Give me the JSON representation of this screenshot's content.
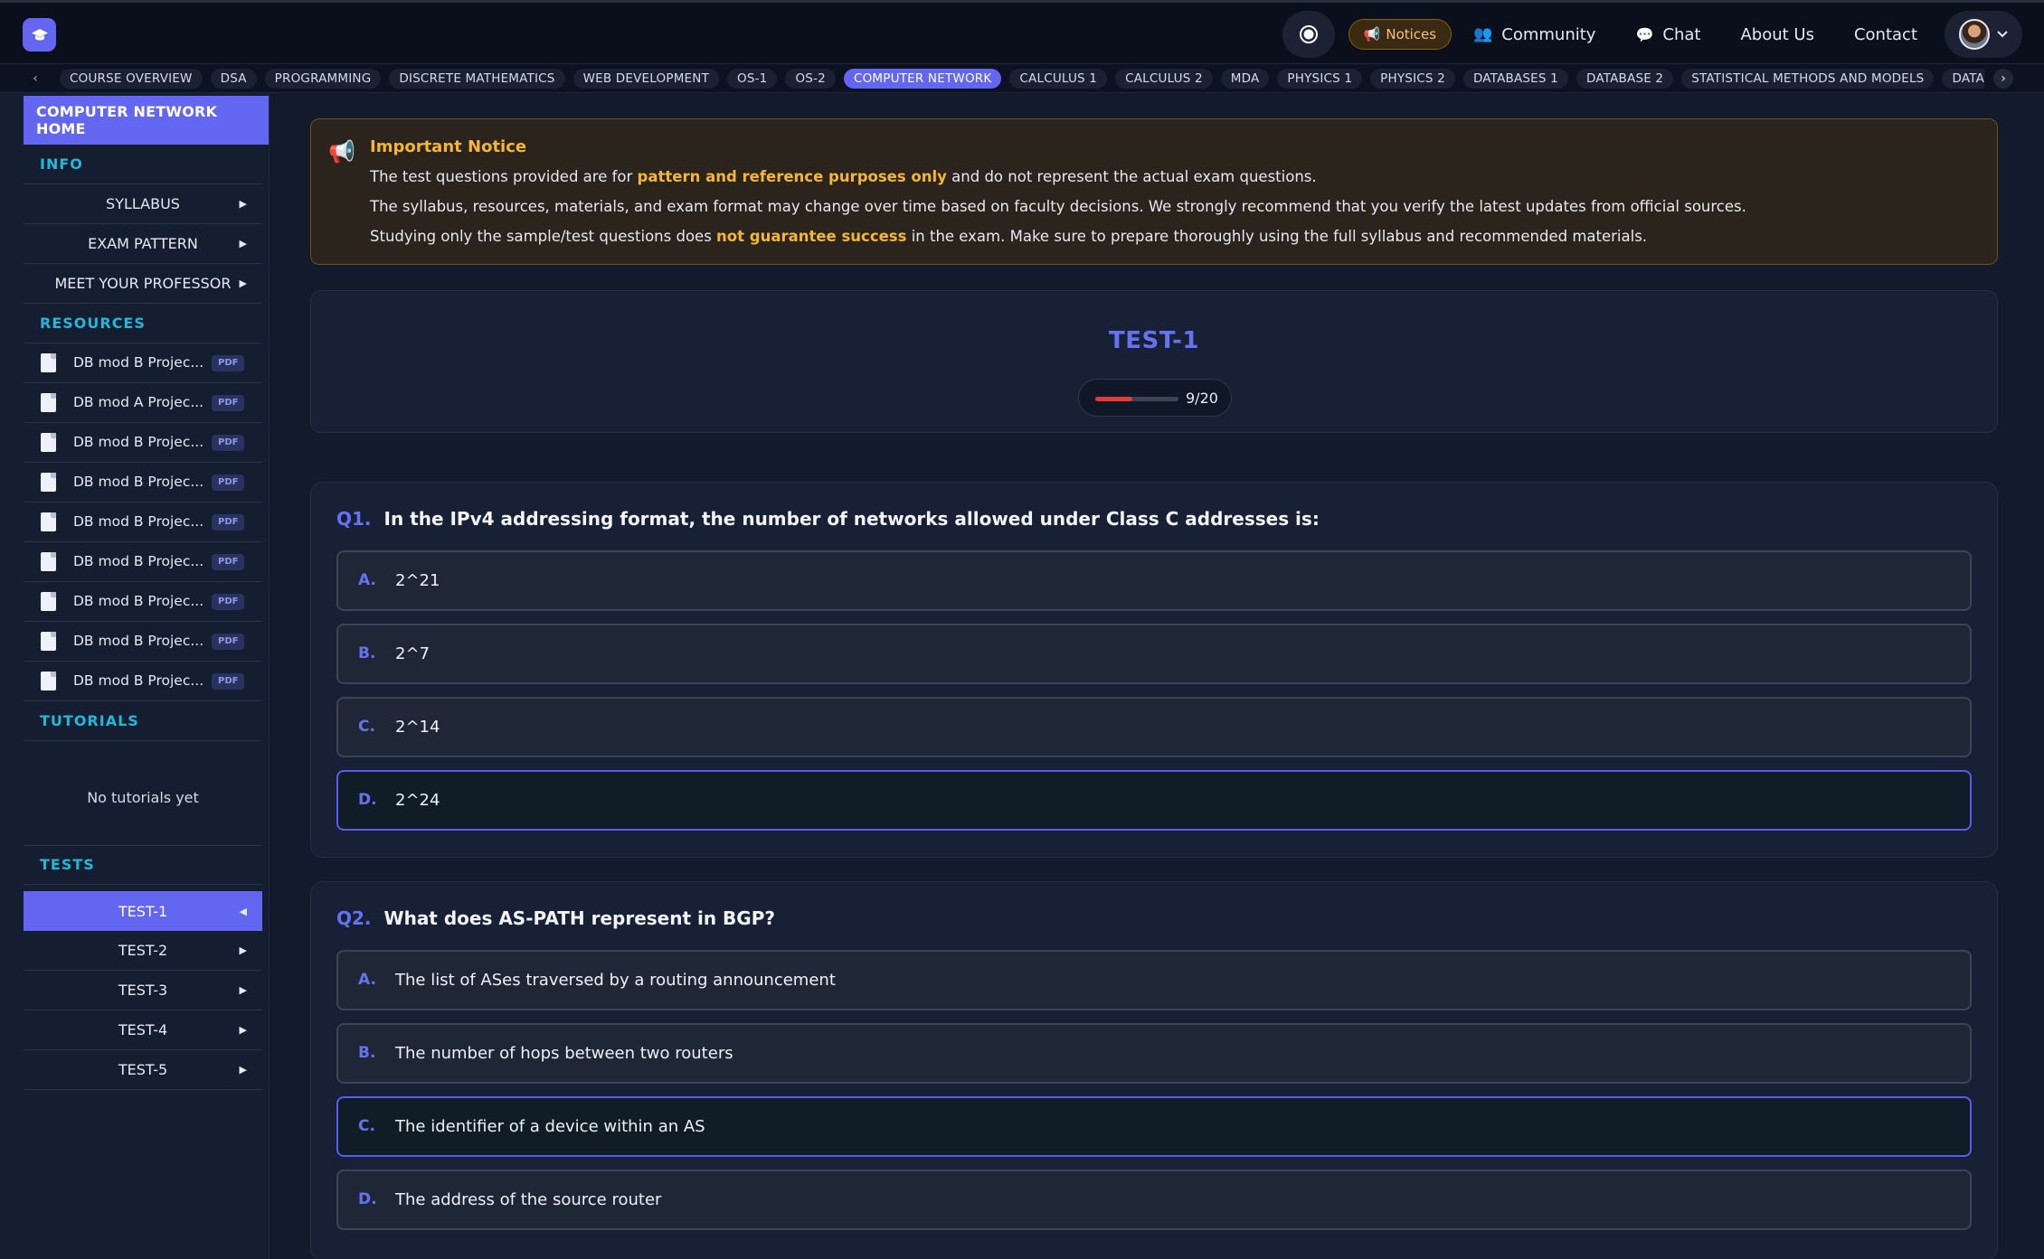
{
  "topbar": {
    "logo_icon": "graduation-cap-icon",
    "notices_label": "Notices",
    "nav": [
      {
        "label": "Community",
        "icon": "users-icon"
      },
      {
        "label": "Chat",
        "icon": "chat-bubble-icon"
      },
      {
        "label": "About Us"
      },
      {
        "label": "Contact"
      }
    ]
  },
  "subjects": [
    "COURSE OVERVIEW",
    "DSA",
    "PROGRAMMING",
    "DISCRETE MATHEMATICS",
    "WEB DEVELOPMENT",
    "OS-1",
    "OS-2",
    "COMPUTER NETWORK",
    "CALCULUS 1",
    "CALCULUS 2",
    "MDA",
    "PHYSICS 1",
    "PHYSICS 2",
    "DATABASES 1",
    "DATABASE 2",
    "STATISTICAL METHODS AND MODELS",
    "DATA MODE"
  ],
  "active_subject": "COMPUTER NETWORK",
  "sidebar": {
    "home_label": "COMPUTER NETWORK HOME",
    "info_label": "INFO",
    "info_items": [
      "SYLLABUS",
      "EXAM PATTERN",
      "MEET YOUR PROFESSOR"
    ],
    "resources_label": "RESOURCES",
    "resources": [
      {
        "name": "DB mod B Projec...",
        "badge": "PDF"
      },
      {
        "name": "DB mod A Projec...",
        "badge": "PDF"
      },
      {
        "name": "DB mod B Projec...",
        "badge": "PDF"
      },
      {
        "name": "DB mod B Projec...",
        "badge": "PDF"
      },
      {
        "name": "DB mod B Projec...",
        "badge": "PDF"
      },
      {
        "name": "DB mod B Projec...",
        "badge": "PDF"
      },
      {
        "name": "DB mod B Projec...",
        "badge": "PDF"
      },
      {
        "name": "DB mod B Projec...",
        "badge": "PDF"
      },
      {
        "name": "DB mod B Projec...",
        "badge": "PDF"
      }
    ],
    "tutorials_label": "TUTORIALS",
    "tutorials_empty": "No tutorials yet",
    "tests_label": "TESTS",
    "tests": [
      "TEST-1",
      "TEST-2",
      "TEST-3",
      "TEST-4",
      "TEST-5"
    ],
    "active_test": "TEST-1"
  },
  "notice": {
    "title": "Important Notice",
    "line1_pre": "The test questions provided are for ",
    "line1_hl": "pattern and reference purposes only",
    "line1_post": " and do not represent the actual exam questions.",
    "line2": "The syllabus, resources, materials, and exam format may change over time based on faculty decisions. We strongly recommend that you verify the latest updates from official sources.",
    "line3_pre": "Studying only the sample/test questions does ",
    "line3_hl": "not guarantee success",
    "line3_post": " in the exam. Make sure to prepare thoroughly using the full syllabus and recommended materials."
  },
  "test": {
    "title": "TEST-1",
    "progress_text": "9/20",
    "progress_fraction": 0.45,
    "progress_color": "#e23b3b"
  },
  "questions": [
    {
      "num": "Q1.",
      "text": "In the IPv4 addressing format, the number of networks allowed under Class C addresses is:",
      "options": [
        {
          "letter": "A.",
          "text": "2^21"
        },
        {
          "letter": "B.",
          "text": "2^7"
        },
        {
          "letter": "C.",
          "text": "2^14"
        },
        {
          "letter": "D.",
          "text": "2^24"
        }
      ],
      "selected": "D."
    },
    {
      "num": "Q2.",
      "text": "What does AS-PATH represent in BGP?",
      "options": [
        {
          "letter": "A.",
          "text": "The list of ASes traversed by a routing announcement"
        },
        {
          "letter": "B.",
          "text": "The number of hops between two routers"
        },
        {
          "letter": "C.",
          "text": "The identifier of a device within an AS"
        },
        {
          "letter": "D.",
          "text": "The address of the source router"
        }
      ],
      "selected": "C."
    }
  ],
  "colors": {
    "accent": "#6366f1",
    "section_heading": "#22b8d8",
    "notice_highlight": "#f5b731"
  }
}
